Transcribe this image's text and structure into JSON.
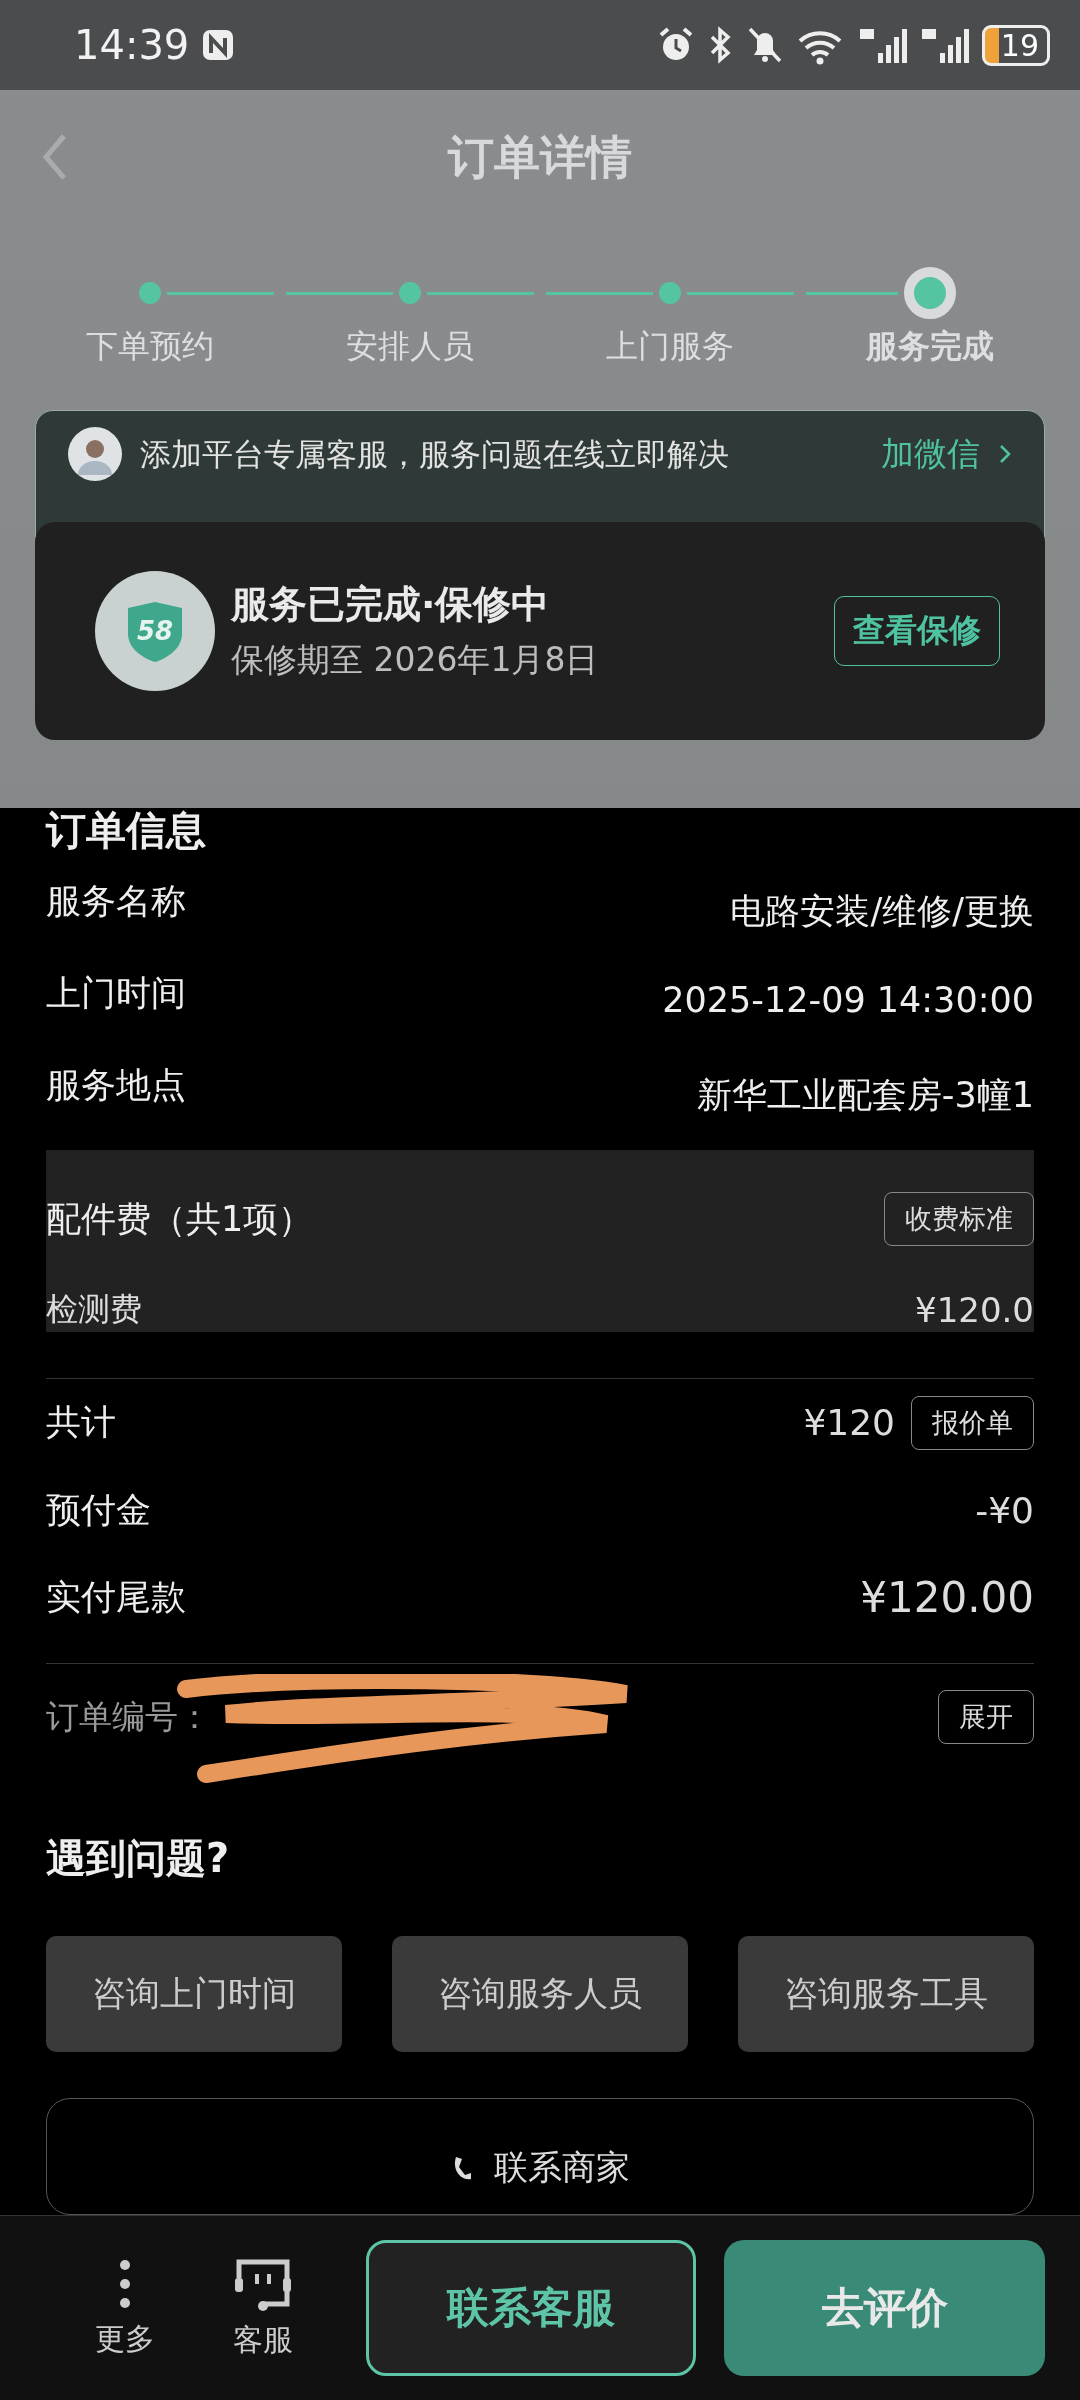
{
  "status_bar": {
    "time": "14:39",
    "battery": "19"
  },
  "header": {
    "title": "订单详情"
  },
  "steps": [
    {
      "label": "下单预约",
      "selected": false
    },
    {
      "label": "安排人员",
      "selected": false
    },
    {
      "label": "上门服务",
      "selected": false
    },
    {
      "label": "服务完成",
      "selected": true
    }
  ],
  "banner": {
    "text": "添加平台专属客服，服务问题在线立即解决",
    "action": "加微信"
  },
  "status_card": {
    "badge": "58",
    "title": "服务已完成·保修中",
    "subtitle": "保修期至 2026年1月8日",
    "button": "查看保修"
  },
  "order_info": {
    "title": "订单信息",
    "rows": [
      {
        "label": "服务名称",
        "value": "电路安装/维修/更换"
      },
      {
        "label": "上门时间",
        "value": "2025-12-09 14:30:00"
      },
      {
        "label": "服务地点",
        "value": "新华工业配套房-3幢1"
      }
    ]
  },
  "fees": {
    "title": "配件费（共1项）",
    "button": "收费标准",
    "items": [
      {
        "label": "检测费",
        "value": "¥120.0"
      }
    ]
  },
  "totals": [
    {
      "label": "共计",
      "value": "¥120",
      "button": "报价单",
      "emphasis": false
    },
    {
      "label": "预付金",
      "value": "-¥0",
      "emphasis": false
    },
    {
      "label": "实付尾款",
      "value": "¥120.00",
      "emphasis": true
    }
  ],
  "order_number": {
    "label": "订单编号：",
    "button": "展开"
  },
  "help": {
    "title": "遇到问题?",
    "options": [
      "咨询上门时间",
      "咨询服务人员",
      "咨询服务工具"
    ]
  },
  "contact_card": {
    "label": "联系商家"
  },
  "bottom_bar": {
    "links": [
      {
        "label": "更多",
        "kind": "more"
      },
      {
        "label": "客服",
        "kind": "service"
      }
    ],
    "secondary": "联系客服",
    "primary": "去评价"
  }
}
